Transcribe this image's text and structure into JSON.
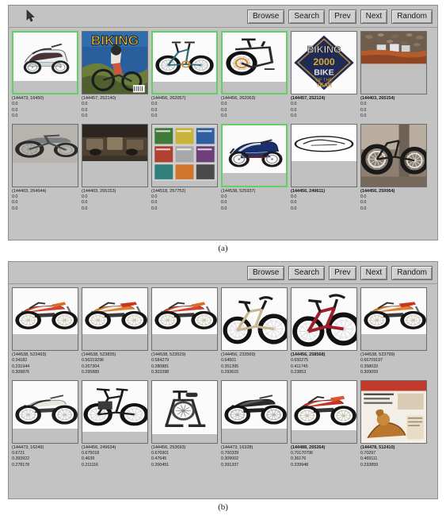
{
  "toolbar": {
    "buttons": [
      "Browse",
      "Search",
      "Prev",
      "Next",
      "Random"
    ],
    "icons": {
      "cursor": "mouse-pointer-icon"
    }
  },
  "captions": {
    "a": "(a)",
    "b": "(b)"
  },
  "colors": {
    "panel_bg": "#c3c3c3",
    "panel_border": "#8e8e8e",
    "selection_green": "#62d163",
    "thumb_border": "#6d6d6d",
    "text": "#1a1a1a"
  },
  "panel_a": {
    "name": "image-browse-results-unranked",
    "rows": [
      {
        "cells": [
          {
            "id": "(144473, 16450)",
            "scores": [
              "0.0",
              "0.0",
              "0.0"
            ],
            "selected": true,
            "bold": false,
            "art": "scooter",
            "fill": 0.8
          },
          {
            "id": "(144457, 252140)",
            "scores": [
              "0.0",
              "0.0",
              "0.0"
            ],
            "selected": false,
            "bold": false,
            "art": "magazine-biking",
            "fill": 1.0
          },
          {
            "id": "(144456, 262057)",
            "scores": [
              "0.0",
              "0.0",
              "0.0"
            ],
            "selected": true,
            "bold": false,
            "art": "folding-bike",
            "fill": 0.82
          },
          {
            "id": "(144456, 262063)",
            "scores": [
              "0.0",
              "0.0",
              "0.0"
            ],
            "selected": true,
            "bold": false,
            "art": "folded-bike",
            "fill": 0.82
          },
          {
            "id": "(144457, 252124)",
            "scores": [
              "0.0",
              "0.0",
              "0.0"
            ],
            "selected": false,
            "bold": true,
            "art": "bike-of-year",
            "fill": 1.0
          },
          {
            "id": "(144403, 265154)",
            "scores": [
              "0.0",
              "0.0",
              "0.0"
            ],
            "selected": false,
            "bold": true,
            "art": "crowd-race",
            "fill": 0.52
          }
        ]
      },
      {
        "cells": [
          {
            "id": "(144403, 264644)",
            "scores": [
              "0.0",
              "0.0",
              "0.0"
            ],
            "selected": false,
            "bold": false,
            "art": "classic-moto",
            "fill": 0.62
          },
          {
            "id": "(144403, 265153)",
            "scores": [
              "0.0",
              "0.0",
              "0.0"
            ],
            "selected": false,
            "bold": false,
            "art": "dark-garage",
            "fill": 0.6
          },
          {
            "id": "(144518, 257752)",
            "scores": [
              "0.0",
              "0.0",
              "0.0"
            ],
            "selected": false,
            "bold": false,
            "art": "magazine-rack",
            "fill": 0.92
          },
          {
            "id": "(144538, 525937)",
            "scores": [
              "0.0",
              "0.0",
              "0.0"
            ],
            "selected": true,
            "bold": false,
            "art": "sport-bike",
            "fill": 0.8
          },
          {
            "id": "(144456, 249611)",
            "scores": [
              "0.0",
              "0.0",
              "0.0"
            ],
            "selected": false,
            "bold": true,
            "art": "oval-outline",
            "fill": 0.6
          },
          {
            "id": "(144456, 250064)",
            "scores": [
              "0.0",
              "0.0",
              "0.0"
            ],
            "selected": false,
            "bold": true,
            "art": "bike-indoor",
            "fill": 1.0
          }
        ]
      }
    ]
  },
  "panel_b": {
    "name": "image-browse-results-ranked",
    "rows": [
      {
        "cells": [
          {
            "id": "(144538, 523493)",
            "scores": [
              "0.34182",
              "0.231944",
              "0.309876"
            ],
            "selected": false,
            "bold": false,
            "art": "dirt-bike-red",
            "fill": 0.74
          },
          {
            "id": "(144538, 523835)",
            "scores": [
              "0.56319296",
              "0.267304",
              "0.295889"
            ],
            "selected": false,
            "bold": false,
            "art": "dirt-bike-org",
            "fill": 0.74
          },
          {
            "id": "(144538, 523529)",
            "scores": [
              "0.584279",
              "0.280881",
              "0.303398"
            ],
            "selected": false,
            "bold": false,
            "art": "dirt-bike-red2",
            "fill": 0.74
          },
          {
            "id": "(144456, 233569)",
            "scores": [
              "0.64501",
              "0.351395",
              "0.293615"
            ],
            "selected": false,
            "bold": false,
            "art": "bmx-tan",
            "fill": 1.0
          },
          {
            "id": "(144456, 258568)",
            "scores": [
              "0.650275",
              "0.411745",
              "0.23853"
            ],
            "selected": false,
            "bold": true,
            "art": "bmx-red",
            "fill": 1.0
          },
          {
            "id": "(144538, 523799)",
            "scores": [
              "0.66709197",
              "0.358033",
              "0.309059"
            ],
            "selected": false,
            "bold": false,
            "art": "dirt-bike-org2",
            "fill": 0.74
          }
        ]
      },
      {
        "cells": [
          {
            "id": "(144473, 16249)",
            "scores": [
              "0.6721",
              "0.393922",
              "0.278178"
            ],
            "selected": false,
            "bold": false,
            "art": "vintage-moto",
            "fill": 0.78
          },
          {
            "id": "(144456, 249634)",
            "scores": [
              "0.675018",
              "0.4639",
              "0.211116"
            ],
            "selected": false,
            "bold": false,
            "art": "city-bike",
            "fill": 0.82
          },
          {
            "id": "(144456, 253693)",
            "scores": [
              "0.676901",
              "0.47645",
              "0.200451"
            ],
            "selected": false,
            "bold": false,
            "art": "exercise-bike",
            "fill": 0.86
          },
          {
            "id": "(144473, 16328)",
            "scores": [
              "0.700339",
              "0.309002",
              "0.391337"
            ],
            "selected": false,
            "bold": false,
            "art": "street-moto",
            "fill": 0.78
          },
          {
            "id": "(144488, 265264)",
            "scores": [
              "0.70170796",
              "0.36176",
              "0.339948"
            ],
            "selected": false,
            "bold": true,
            "art": "red-dirt-moto",
            "fill": 0.8
          },
          {
            "id": "(144478, 512410)",
            "scores": [
              "0.70297",
              "0.469111",
              "0.233859"
            ],
            "selected": false,
            "bold": true,
            "art": "ad-flyer",
            "fill": 1.0
          }
        ]
      }
    ]
  }
}
